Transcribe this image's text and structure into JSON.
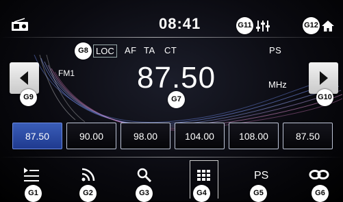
{
  "status_bar": {
    "time": "08:41"
  },
  "flags": {
    "loc": "LOC",
    "af": "AF",
    "ta": "TA",
    "ct": "CT",
    "ps": "PS"
  },
  "tuner": {
    "band": "FM1",
    "frequency": "87.50",
    "unit": "MHz"
  },
  "presets": [
    {
      "label": "87.50",
      "active": true
    },
    {
      "label": "90.00",
      "active": false
    },
    {
      "label": "98.00",
      "active": false
    },
    {
      "label": "104.00",
      "active": false
    },
    {
      "label": "108.00",
      "active": false
    },
    {
      "label": "87.50",
      "active": false
    }
  ],
  "toolbar": {
    "ps_label": "PS"
  },
  "callouts": {
    "g1": "G1",
    "g2": "G2",
    "g3": "G3",
    "g4": "G4",
    "g5": "G5",
    "g6": "G6",
    "g7": "G7",
    "g8": "G8",
    "g9": "G9",
    "g10": "G10",
    "g11": "G11",
    "g12": "G12"
  },
  "colors": {
    "accent": "#2f55b5",
    "background": "#000000"
  }
}
